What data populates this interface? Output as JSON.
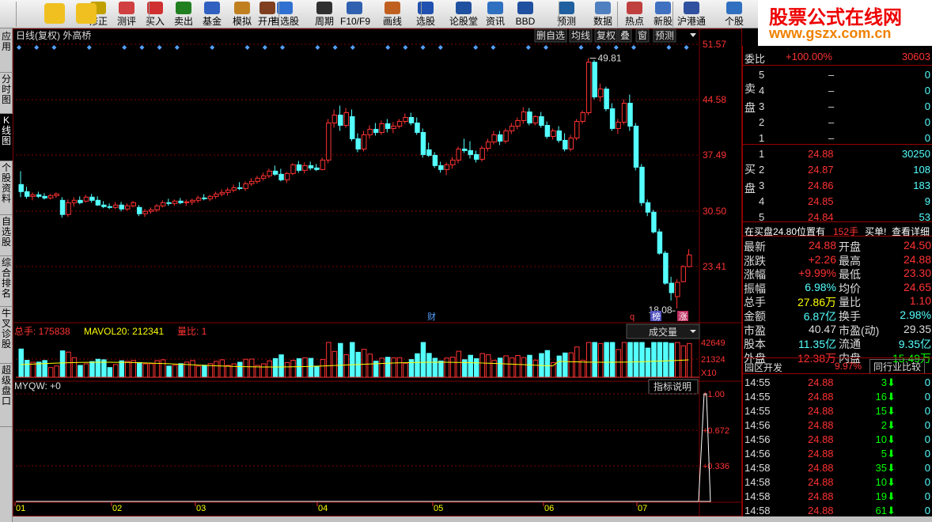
{
  "toolbar": {
    "buttons": [
      {
        "label": "修正",
        "icon": "fix-icon"
      },
      {
        "label": "测评",
        "icon": "clock-icon"
      },
      {
        "label": "买入",
        "icon": "buy-icon"
      },
      {
        "label": "卖出",
        "icon": "sell-icon"
      },
      {
        "label": "基金",
        "icon": "fund-icon"
      },
      {
        "label": "模拟",
        "icon": "simulate-icon"
      },
      {
        "label": "开户",
        "icon": "account-icon"
      },
      {
        "label": "自选股",
        "icon": "star-icon"
      },
      {
        "label": "周期",
        "icon": "period-icon"
      },
      {
        "label": "F10/F9",
        "icon": "f10-icon"
      },
      {
        "label": "画线",
        "icon": "draw-icon"
      },
      {
        "label": "选股",
        "icon": "select-icon"
      },
      {
        "label": "论股堂",
        "icon": "forum-icon"
      },
      {
        "label": "资讯",
        "icon": "news-icon"
      },
      {
        "label": "BBD",
        "icon": "bbd-icon"
      },
      {
        "label": "预测",
        "icon": "forecast-icon"
      },
      {
        "label": "数据",
        "icon": "data-icon"
      },
      {
        "label": "热点",
        "icon": "hot-icon"
      },
      {
        "label": "新股",
        "icon": "ipo-icon"
      },
      {
        "label": "沪港通",
        "icon": "hk-icon"
      },
      {
        "label": "个股",
        "icon": "stock-icon"
      }
    ]
  },
  "logo": {
    "title": "股票公式在线网",
    "url": "www.gszx.com.cn"
  },
  "sidebar": [
    {
      "label": "应用"
    },
    {
      "label": "分时图"
    },
    {
      "label": "K线图"
    },
    {
      "label": "个股资料"
    },
    {
      "label": "自选股"
    },
    {
      "label": "综合排名"
    },
    {
      "label": "牛叉诊股"
    },
    {
      "label": "超级盘口"
    }
  ],
  "chart": {
    "title": "日线(复权) 外高桥",
    "top_buttons": [
      "删自选",
      "均线",
      "复权",
      "叠",
      "窗",
      "预测"
    ],
    "price_axis": [
      "51.57",
      "44.58",
      "37.49",
      "30.50",
      "23.41"
    ],
    "max_label": "49.81",
    "min_label": "18.08",
    "markers": [
      "财",
      "q",
      "榜",
      "涨"
    ],
    "volume_info": {
      "total": "总手: 175838",
      "mavol": "MAVOL20: 212341",
      "ratio": "量比: 1"
    },
    "volume_dropdown": "成交量",
    "volume_axis": [
      "42649",
      "21324",
      "X10"
    ],
    "indicator_label": "MYQW: +0",
    "indicator_button": "指标说明",
    "indicator_axis": [
      "+1.00",
      "+0.672",
      "+0.336"
    ],
    "months": [
      "01",
      "02",
      "03",
      "04",
      "05",
      "06",
      "07"
    ],
    "colors": {
      "up": "#ff3232",
      "down": "#54ffff",
      "grid": "#800000",
      "ma": "#ffff00"
    }
  },
  "chart_data": {
    "type": "candlestick",
    "title": "日线(复权) 外高桥",
    "y_ticks": [
      51.57,
      44.58,
      37.49,
      30.5,
      23.41
    ],
    "annotated_high": 49.81,
    "annotated_low": 18.08,
    "candles": [
      [
        33.8,
        35.5,
        32.2,
        32.9
      ],
      [
        32.9,
        33.5,
        32.0,
        32.3
      ],
      [
        32.3,
        32.8,
        31.8,
        32.5
      ],
      [
        32.5,
        32.9,
        32.1,
        32.3
      ],
      [
        32.3,
        32.7,
        31.9,
        32.1
      ],
      [
        32.1,
        32.6,
        31.9,
        32.4
      ],
      [
        32.4,
        32.8,
        32.1,
        32.6
      ],
      [
        31.8,
        32.2,
        29.6,
        30.0
      ],
      [
        30.0,
        31.9,
        29.7,
        31.5
      ],
      [
        31.5,
        32.2,
        31.0,
        31.8
      ],
      [
        31.8,
        32.3,
        31.3,
        31.5
      ],
      [
        31.7,
        32.5,
        31.5,
        32.2
      ],
      [
        32.2,
        32.6,
        31.5,
        31.8
      ],
      [
        31.8,
        32.3,
        31.1,
        31.2
      ],
      [
        31.2,
        31.7,
        30.8,
        31.0
      ],
      [
        31.0,
        31.4,
        30.7,
        30.9
      ],
      [
        30.9,
        31.6,
        30.7,
        31.2
      ],
      [
        31.2,
        31.6,
        30.4,
        30.7
      ],
      [
        30.7,
        31.4,
        30.5,
        31.1
      ],
      [
        31.1,
        31.7,
        30.9,
        31.5
      ],
      [
        30.9,
        31.2,
        29.8,
        30.1
      ],
      [
        30.1,
        30.7,
        29.7,
        30.4
      ],
      [
        30.4,
        30.9,
        30.1,
        30.6
      ],
      [
        30.6,
        31.3,
        30.3,
        31.1
      ],
      [
        31.1,
        31.8,
        30.9,
        31.5
      ],
      [
        31.5,
        32.0,
        31.1,
        31.4
      ],
      [
        31.4,
        31.9,
        31.1,
        31.7
      ],
      [
        31.7,
        32.1,
        31.3,
        31.5
      ],
      [
        31.5,
        31.9,
        31.1,
        31.6
      ],
      [
        31.6,
        32.0,
        31.2,
        31.8
      ],
      [
        31.8,
        32.4,
        31.5,
        32.1
      ],
      [
        32.1,
        32.6,
        31.8,
        32.0
      ],
      [
        32.0,
        32.5,
        31.7,
        32.3
      ],
      [
        32.3,
        32.9,
        32.0,
        32.6
      ],
      [
        32.6,
        33.2,
        32.3,
        32.8
      ],
      [
        32.8,
        33.4,
        32.4,
        33.1
      ],
      [
        33.1,
        33.8,
        32.8,
        33.4
      ],
      [
        33.4,
        34.1,
        33.1,
        33.3
      ],
      [
        33.3,
        34.2,
        33.0,
        33.9
      ],
      [
        33.9,
        34.6,
        33.6,
        34.2
      ],
      [
        34.2,
        34.9,
        33.9,
        34.6
      ],
      [
        34.6,
        35.3,
        34.3,
        34.9
      ],
      [
        34.9,
        35.8,
        34.6,
        35.5
      ],
      [
        35.5,
        36.2,
        34.9,
        35.1
      ],
      [
        35.1,
        35.8,
        34.2,
        34.4
      ],
      [
        34.4,
        35.4,
        34.0,
        35.2
      ],
      [
        35.2,
        36.5,
        35.0,
        36.3
      ],
      [
        36.3,
        36.8,
        35.3,
        35.6
      ],
      [
        35.6,
        36.6,
        35.2,
        36.2
      ],
      [
        36.2,
        36.7,
        35.6,
        35.9
      ],
      [
        35.9,
        36.4,
        35.5,
        35.7
      ],
      [
        35.7,
        37.2,
        35.6,
        36.9
      ],
      [
        36.9,
        42.1,
        36.5,
        41.6
      ],
      [
        41.6,
        43.3,
        41.0,
        42.6
      ],
      [
        42.6,
        43.8,
        40.6,
        41.3
      ],
      [
        41.3,
        43.5,
        41.0,
        42.9
      ],
      [
        42.4,
        43.3,
        39.3,
        39.6
      ],
      [
        39.6,
        40.3,
        37.9,
        38.3
      ],
      [
        38.3,
        40.6,
        38.0,
        40.1
      ],
      [
        40.1,
        41.3,
        39.6,
        40.8
      ],
      [
        40.8,
        41.6,
        40.0,
        40.4
      ],
      [
        40.4,
        41.9,
        40.1,
        41.5
      ],
      [
        41.5,
        42.1,
        40.4,
        40.9
      ],
      [
        40.9,
        41.7,
        40.3,
        41.2
      ],
      [
        41.2,
        42.1,
        40.9,
        41.8
      ],
      [
        41.8,
        42.8,
        41.5,
        42.3
      ],
      [
        42.3,
        42.9,
        41.3,
        41.6
      ],
      [
        41.6,
        42.3,
        40.1,
        40.4
      ],
      [
        40.4,
        40.9,
        37.2,
        37.6
      ],
      [
        38.2,
        39.1,
        37.3,
        37.5
      ],
      [
        37.5,
        37.9,
        35.9,
        36.2
      ],
      [
        36.2,
        36.7,
        35.3,
        35.7
      ],
      [
        35.7,
        36.6,
        35.0,
        36.3
      ],
      [
        36.3,
        37.3,
        35.8,
        36.9
      ],
      [
        36.9,
        38.6,
        36.5,
        38.3
      ],
      [
        38.3,
        39.6,
        37.8,
        38.1
      ],
      [
        38.1,
        39.3,
        37.1,
        37.6
      ],
      [
        37.6,
        38.1,
        36.6,
        37.0
      ],
      [
        37.0,
        38.7,
        36.7,
        38.4
      ],
      [
        38.4,
        39.6,
        38.0,
        39.2
      ],
      [
        39.2,
        40.6,
        38.9,
        40.1
      ],
      [
        40.1,
        40.6,
        38.8,
        39.3
      ],
      [
        39.3,
        40.9,
        39.0,
        40.6
      ],
      [
        40.6,
        41.6,
        40.2,
        41.2
      ],
      [
        41.2,
        42.3,
        40.8,
        41.9
      ],
      [
        41.9,
        43.6,
        41.5,
        43.0
      ],
      [
        43.0,
        43.5,
        41.3,
        41.6
      ],
      [
        41.6,
        42.6,
        41.3,
        42.4
      ],
      [
        42.4,
        43.0,
        41.0,
        41.3
      ],
      [
        41.3,
        41.8,
        39.6,
        39.9
      ],
      [
        39.9,
        40.9,
        39.5,
        40.6
      ],
      [
        40.6,
        41.2,
        39.1,
        39.4
      ],
      [
        39.4,
        40.3,
        38.0,
        38.3
      ],
      [
        38.3,
        40.1,
        38.0,
        39.7
      ],
      [
        39.7,
        42.1,
        39.4,
        41.8
      ],
      [
        41.8,
        43.2,
        41.5,
        42.9
      ],
      [
        42.9,
        49.81,
        42.6,
        49.3
      ],
      [
        49.3,
        49.6,
        44.6,
        44.9
      ],
      [
        44.9,
        46.6,
        44.3,
        45.9
      ],
      [
        45.9,
        46.2,
        43.1,
        43.4
      ],
      [
        43.4,
        44.1,
        40.6,
        40.9
      ],
      [
        40.9,
        42.1,
        40.2,
        41.7
      ],
      [
        41.7,
        44.6,
        41.4,
        44.1
      ],
      [
        44.1,
        45.2,
        40.6,
        41.2
      ],
      [
        41.2,
        41.6,
        35.6,
        36.0
      ],
      [
        36.0,
        36.4,
        31.1,
        31.5
      ],
      [
        31.5,
        31.9,
        29.8,
        30.3
      ],
      [
        30.3,
        30.6,
        27.6,
        27.8
      ],
      [
        27.8,
        28.2,
        24.9,
        25.1
      ],
      [
        25.1,
        25.4,
        21.1,
        21.3
      ],
      [
        21.3,
        22.1,
        19.1,
        20.1
      ],
      [
        19.6,
        21.8,
        18.08,
        21.4
      ],
      [
        21.5,
        23.6,
        21.4,
        23.4
      ],
      [
        23.4,
        25.6,
        23.3,
        24.88
      ]
    ],
    "volume_axis_ticks": [
      42649,
      21324
    ],
    "volume_unit": "X10",
    "indicator": {
      "name": "MYQW",
      "value": 0,
      "axis": [
        1.0,
        0.672,
        0.336
      ],
      "spike_index": 116
    }
  },
  "right": {
    "weibi_label": "委比",
    "weibi_value": "+100.00%",
    "weicha_value": "30603",
    "sell_label": "卖盘",
    "buy_label": "买盘",
    "sells": [
      {
        "lvl": "5",
        "price": "–",
        "vol": "0"
      },
      {
        "lvl": "4",
        "price": "–",
        "vol": "0"
      },
      {
        "lvl": "3",
        "price": "–",
        "vol": "0"
      },
      {
        "lvl": "2",
        "price": "–",
        "vol": "0"
      },
      {
        "lvl": "1",
        "price": "–",
        "vol": "0"
      }
    ],
    "buys": [
      {
        "lvl": "1",
        "price": "24.88",
        "vol": "30250"
      },
      {
        "lvl": "2",
        "price": "24.87",
        "vol": "108"
      },
      {
        "lvl": "3",
        "price": "24.86",
        "vol": "183"
      },
      {
        "lvl": "4",
        "price": "24.85",
        "vol": "9"
      },
      {
        "lvl": "5",
        "price": "24.84",
        "vol": "53"
      }
    ],
    "notice": {
      "text": "在买盘24.80位置有",
      "qty": "152手",
      "action": "买单!",
      "link": "查看详细"
    },
    "stats": [
      {
        "k1": "最新",
        "v1": "24.88",
        "k2": "开盘",
        "v2": "24.50",
        "c1": "#ff3232",
        "c2": "#ff3232"
      },
      {
        "k1": "涨跌",
        "v1": "+2.26",
        "k2": "最高",
        "v2": "24.88",
        "c1": "#ff3232",
        "c2": "#ff3232"
      },
      {
        "k1": "涨幅",
        "v1": "+9.99%",
        "k2": "最低",
        "v2": "23.30",
        "c1": "#ff3232",
        "c2": "#ff3232"
      },
      {
        "k1": "振幅",
        "v1": "6.98%",
        "k2": "均价",
        "v2": "24.65",
        "c1": "#54ffff",
        "c2": "#ff3232"
      },
      {
        "k1": "总手",
        "v1": "27.86万",
        "k2": "量比",
        "v2": "1.10",
        "c1": "#ffff00",
        "c2": "#ff3232"
      },
      {
        "k1": "金额",
        "v1": "6.87亿",
        "k2": "换手",
        "v2": "2.98%",
        "c1": "#54ffff",
        "c2": "#54ffff"
      },
      {
        "k1": "市盈",
        "v1": "40.47",
        "k2": "市盈(动)",
        "v2": "29.35",
        "c1": "#dddddd",
        "c2": "#dddddd"
      },
      {
        "k1": "股本",
        "v1": "11.35亿",
        "k2": "流通",
        "v2": "9.35亿",
        "c1": "#54ffff",
        "c2": "#54ffff"
      },
      {
        "k1": "外盘",
        "v1": "12.38万",
        "k2": "内盘",
        "v2": "15.49万",
        "c1": "#ff3232",
        "c2": "#00ff00"
      }
    ],
    "sector": {
      "name": "园区开发",
      "change": "9.97%",
      "compare": "同行业比较"
    },
    "ticks": [
      {
        "t": "14:55",
        "p": "24.88",
        "v": "3"
      },
      {
        "t": "14:55",
        "p": "24.88",
        "v": "16"
      },
      {
        "t": "14:55",
        "p": "24.88",
        "v": "15"
      },
      {
        "t": "14:56",
        "p": "24.88",
        "v": "2"
      },
      {
        "t": "14:56",
        "p": "24.88",
        "v": "10"
      },
      {
        "t": "14:56",
        "p": "24.88",
        "v": "5"
      },
      {
        "t": "14:58",
        "p": "24.88",
        "v": "35"
      },
      {
        "t": "14:58",
        "p": "24.88",
        "v": "10"
      },
      {
        "t": "14:58",
        "p": "24.88",
        "v": "19"
      },
      {
        "t": "14:58",
        "p": "24.88",
        "v": "61"
      }
    ]
  }
}
